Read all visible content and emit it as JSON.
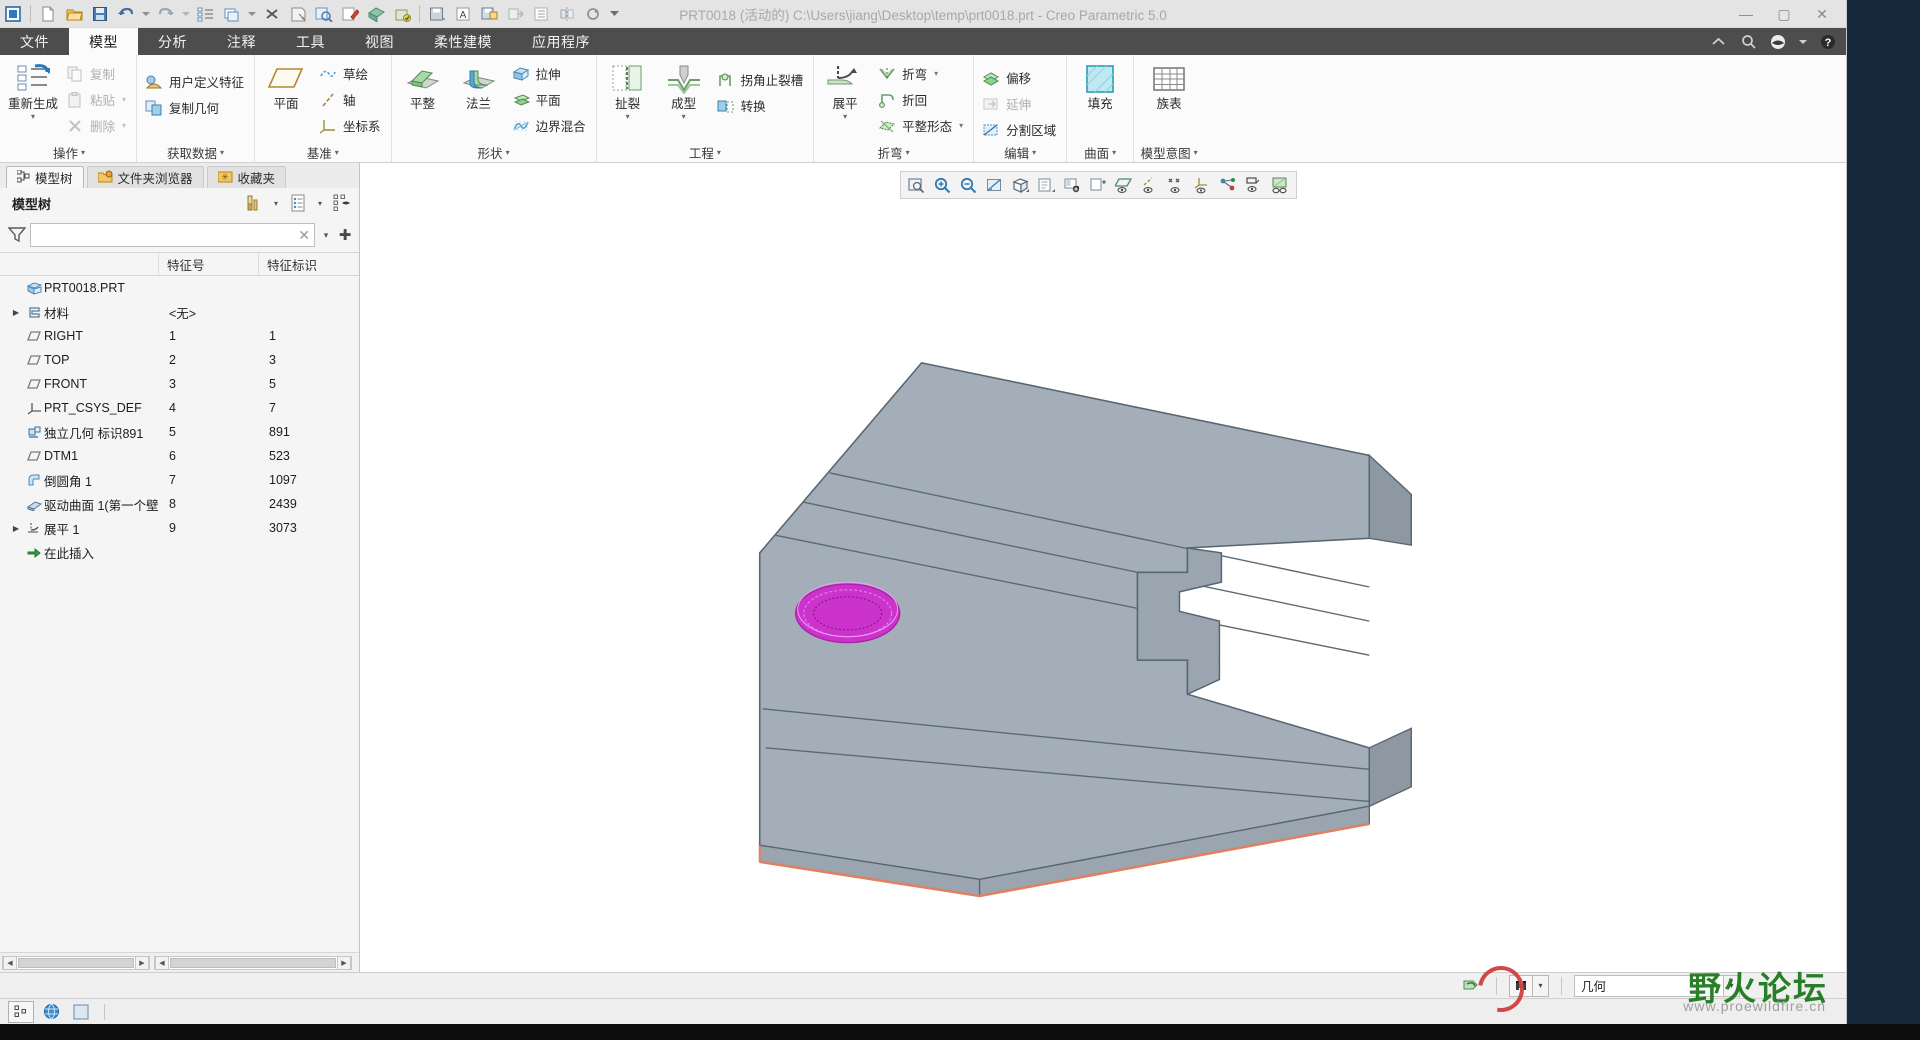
{
  "window": {
    "title": "PRT0018 (活动的) C:\\Users\\jiang\\Desktop\\temp\\prt0018.prt - Creo Parametric 5.0",
    "minimize": "—",
    "maximize": "▢",
    "close": "✕"
  },
  "quick_access": {
    "items": [
      {
        "name": "creo-logo-icon",
        "label": "Creo"
      },
      {
        "name": "new-file-icon",
        "label": "新建"
      },
      {
        "name": "open-file-icon",
        "label": "打开"
      },
      {
        "name": "save-icon",
        "label": "保存"
      },
      {
        "name": "undo-icon",
        "label": "撤消"
      },
      {
        "name": "undo-dropdown-icon",
        "label": "撤消下拉"
      },
      {
        "name": "redo-icon",
        "label": "重做"
      },
      {
        "name": "redo-dropdown-icon",
        "label": "重做下拉"
      },
      {
        "name": "regenerate-icon",
        "label": "重新生成"
      },
      {
        "name": "window-icon",
        "label": "窗口"
      },
      {
        "name": "window-dropdown-icon",
        "label": "窗口下拉"
      },
      {
        "name": "close-window-icon",
        "label": "关闭"
      },
      {
        "name": "save-as-icon",
        "label": "另存为"
      },
      {
        "name": "zoom-find-icon",
        "label": "查找"
      },
      {
        "name": "edit-def-icon",
        "label": "编辑定义"
      },
      {
        "name": "appearance-icon",
        "label": "外观"
      },
      {
        "name": "color-edit-icon",
        "label": "颜色编辑"
      },
      {
        "name": "save-model-icon",
        "label": "保存模型"
      },
      {
        "name": "annotate-icon",
        "label": "注释"
      },
      {
        "name": "save-copy-icon",
        "label": "保存副本"
      },
      {
        "name": "export-icon",
        "label": "导出"
      },
      {
        "name": "list-icon",
        "label": "列表"
      },
      {
        "name": "mirror-icon",
        "label": "镜像"
      },
      {
        "name": "refresh-icon",
        "label": "刷新"
      },
      {
        "name": "qat-overflow-icon",
        "label": "更多"
      }
    ]
  },
  "ribbon": {
    "tabs": [
      {
        "label": "文件",
        "active": false,
        "name": "tab-file"
      },
      {
        "label": "模型",
        "active": true,
        "name": "tab-model"
      },
      {
        "label": "分析",
        "active": false,
        "name": "tab-analysis"
      },
      {
        "label": "注释",
        "active": false,
        "name": "tab-annotate"
      },
      {
        "label": "工具",
        "active": false,
        "name": "tab-tools"
      },
      {
        "label": "视图",
        "active": false,
        "name": "tab-view"
      },
      {
        "label": "柔性建模",
        "active": false,
        "name": "tab-flexible-modeling"
      },
      {
        "label": "应用程序",
        "active": false,
        "name": "tab-applications"
      }
    ],
    "groups": [
      {
        "title": "操作",
        "name": "ribbon-group-operations",
        "big": [
          {
            "label": "重新生成",
            "icon": "regenerate-icon",
            "caret": true
          }
        ],
        "small": [
          {
            "label": "复制",
            "icon": "copy-icon",
            "disabled": true,
            "caret": false
          },
          {
            "label": "粘贴",
            "icon": "paste-icon",
            "disabled": true,
            "caret": true
          },
          {
            "label": "删除",
            "icon": "delete-icon",
            "disabled": true,
            "caret": true
          }
        ]
      },
      {
        "title": "获取数据",
        "name": "ribbon-group-get-data",
        "big": [],
        "small": [
          {
            "label": "用户定义特征",
            "icon": "udf-icon",
            "disabled": false,
            "caret": false
          },
          {
            "label": "复制几何",
            "icon": "copy-geometry-icon",
            "disabled": false,
            "caret": false
          }
        ]
      },
      {
        "title": "基准",
        "name": "ribbon-group-datum",
        "big": [
          {
            "label": "平面",
            "icon": "datum-plane-icon",
            "caret": false
          }
        ],
        "small": [
          {
            "label": "草绘",
            "icon": "sketch-icon",
            "disabled": false,
            "caret": false
          },
          {
            "label": "轴",
            "icon": "datum-axis-icon",
            "disabled": false,
            "caret": false
          },
          {
            "label": "坐标系",
            "icon": "coordinate-system-icon",
            "disabled": false,
            "caret": false
          }
        ]
      },
      {
        "title": "形状",
        "name": "ribbon-group-shape",
        "big": [
          {
            "label": "平整",
            "icon": "flat-wall-icon",
            "caret": false
          },
          {
            "label": "法兰",
            "icon": "flange-wall-icon",
            "caret": false
          }
        ],
        "small": [
          {
            "label": "拉伸",
            "icon": "extrude-icon",
            "disabled": false,
            "caret": false
          },
          {
            "label": "平面",
            "icon": "planar-icon",
            "disabled": false,
            "caret": false
          },
          {
            "label": "边界混合",
            "icon": "boundary-blend-icon",
            "disabled": false,
            "caret": false
          }
        ]
      },
      {
        "title": "工程",
        "name": "ribbon-group-engineering",
        "big": [
          {
            "label": "扯裂",
            "icon": "rip-icon",
            "caret": true
          },
          {
            "label": "成型",
            "icon": "form-icon",
            "caret": true
          }
        ],
        "small": [
          {
            "label": "拐角止裂槽",
            "icon": "corner-relief-icon",
            "disabled": false,
            "caret": false
          },
          {
            "label": "转换",
            "icon": "convert-icon",
            "disabled": false,
            "caret": false
          }
        ]
      },
      {
        "title": "折弯",
        "name": "ribbon-group-bend",
        "big": [
          {
            "label": "展平",
            "icon": "unbend-icon",
            "caret": true
          }
        ],
        "small": [
          {
            "label": "折弯",
            "icon": "bend-icon",
            "disabled": false,
            "caret": true
          },
          {
            "label": "折回",
            "icon": "bend-back-icon",
            "disabled": false,
            "caret": false
          },
          {
            "label": "平整形态",
            "icon": "flat-state-icon",
            "disabled": false,
            "caret": true
          }
        ]
      },
      {
        "title": "编辑",
        "name": "ribbon-group-edit",
        "big": [],
        "small": [
          {
            "label": "偏移",
            "icon": "offset-icon",
            "disabled": false,
            "caret": false
          },
          {
            "label": "延伸",
            "icon": "extend-icon",
            "disabled": true,
            "caret": false
          },
          {
            "label": "分割区域",
            "icon": "split-area-icon",
            "disabled": false,
            "caret": false
          }
        ]
      },
      {
        "title": "曲面",
        "name": "ribbon-group-surface",
        "big": [
          {
            "label": "填充",
            "icon": "fill-icon",
            "caret": false
          }
        ],
        "small": []
      },
      {
        "title": "模型意图",
        "name": "ribbon-group-model-intent",
        "big": [
          {
            "label": "族表",
            "icon": "family-table-icon",
            "caret": false
          }
        ],
        "small": []
      }
    ],
    "right_controls": [
      {
        "name": "ribbon-collapse-icon",
        "label": "^"
      },
      {
        "name": "search-icon",
        "label": "search"
      },
      {
        "name": "help-center-icon",
        "label": "help"
      },
      {
        "name": "help-dropdown-icon",
        "label": "▾"
      },
      {
        "name": "help-icon",
        "label": "?"
      }
    ]
  },
  "left_panel": {
    "nav_tabs": [
      {
        "label": "模型树",
        "active": true,
        "icon": "model-tree-icon",
        "name": "nav-tab-model-tree"
      },
      {
        "label": "文件夹浏览器",
        "active": false,
        "icon": "folder-browser-icon",
        "name": "nav-tab-folder-browser"
      },
      {
        "label": "收藏夹",
        "active": false,
        "icon": "favorites-icon",
        "name": "nav-tab-favorites"
      }
    ],
    "header": {
      "title": "模型树",
      "tools_icon": "tree-tools-icon",
      "settings_icon": "tree-settings-icon",
      "display_icon": "tree-display-icon"
    },
    "filter": {
      "icon": "filter-icon",
      "value": "",
      "placeholder": "",
      "clear": "✕",
      "dropdown": "▾",
      "add": "✚"
    },
    "columns": {
      "name": "",
      "feature_no": "特征号",
      "feature_id": "特征标识"
    },
    "tree": [
      {
        "label": "PRT0018.PRT",
        "no": "",
        "id": "",
        "icon": "part-icon",
        "expand": "none",
        "indent": 0,
        "name": "tree-item-part"
      },
      {
        "label": "材料",
        "no": "<无>",
        "id": "",
        "icon": "material-icon",
        "expand": "collapsed",
        "indent": 1,
        "name": "tree-item-material"
      },
      {
        "label": "RIGHT",
        "no": "1",
        "id": "1",
        "icon": "datum-plane-icon",
        "expand": "none",
        "indent": 1,
        "name": "tree-item-right"
      },
      {
        "label": "TOP",
        "no": "2",
        "id": "3",
        "icon": "datum-plane-icon",
        "expand": "none",
        "indent": 1,
        "name": "tree-item-top"
      },
      {
        "label": "FRONT",
        "no": "3",
        "id": "5",
        "icon": "datum-plane-icon",
        "expand": "none",
        "indent": 1,
        "name": "tree-item-front"
      },
      {
        "label": "PRT_CSYS_DEF",
        "no": "4",
        "id": "7",
        "icon": "coordinate-system-icon",
        "expand": "none",
        "indent": 1,
        "name": "tree-item-csys"
      },
      {
        "label": "独立几何 标识891",
        "no": "5",
        "id": "891",
        "icon": "independent-geometry-icon",
        "expand": "none",
        "indent": 1,
        "name": "tree-item-independent-geometry"
      },
      {
        "label": "DTM1",
        "no": "6",
        "id": "523",
        "icon": "datum-plane-icon",
        "expand": "none",
        "indent": 1,
        "name": "tree-item-dtm1"
      },
      {
        "label": "倒圆角 1",
        "no": "7",
        "id": "1097",
        "icon": "round-icon",
        "expand": "none",
        "indent": 1,
        "name": "tree-item-round1"
      },
      {
        "label": "驱动曲面 1(第一个壁",
        "no": "8",
        "id": "2439",
        "icon": "driving-surface-icon",
        "expand": "none",
        "indent": 1,
        "name": "tree-item-driving-surface1"
      },
      {
        "label": "展平 1",
        "no": "9",
        "id": "3073",
        "icon": "unbend-icon",
        "expand": "collapsed",
        "indent": 1,
        "name": "tree-item-unbend1"
      },
      {
        "label": "在此插入",
        "no": "",
        "id": "",
        "icon": "insert-here-icon",
        "expand": "none",
        "indent": 1,
        "name": "tree-item-insert-here"
      }
    ]
  },
  "viewport": {
    "toolbar": [
      {
        "name": "zoom-to-fit-icon",
        "label": "重新调整"
      },
      {
        "name": "zoom-in-icon",
        "label": "放大"
      },
      {
        "name": "zoom-out-icon",
        "label": "缩小"
      },
      {
        "name": "repaint-icon",
        "label": "重画"
      },
      {
        "name": "saved-orientation-icon",
        "label": "已保存方向",
        "caret": true
      },
      {
        "name": "view-manager-icon",
        "label": "视图管理器",
        "caret": true
      },
      {
        "name": "model-display-icon",
        "label": "模型显示"
      },
      {
        "name": "scene-icon",
        "label": "场景"
      },
      {
        "name": "datum-plane-display-icon",
        "label": "平面显示"
      },
      {
        "name": "datum-axis-display-icon",
        "label": "轴显示"
      },
      {
        "name": "datum-point-display-icon",
        "label": "点显示"
      },
      {
        "name": "csys-display-icon",
        "label": "坐标系显示"
      },
      {
        "name": "annotation-display-icon",
        "label": "注释显示"
      },
      {
        "name": "spin-center-icon",
        "label": "旋转中心",
        "caret": true
      },
      {
        "name": "display-style-icon",
        "label": "显示样式"
      }
    ],
    "model": {
      "name": "sheet-metal-part",
      "body_color": "#9aa5b0",
      "edge_color": "#5a646e",
      "highlight_color": "#cc33cc",
      "bottom_edge_color": "#e08060"
    }
  },
  "status_bar": {
    "regenerate_icon": "regenerate-status-icon",
    "search_icon": "binoculars-icon",
    "search_caret": "▾",
    "filter_value": "几何",
    "filter_caret": "▾"
  },
  "bottom_dock": [
    {
      "name": "layer-tree-icon",
      "label": "层树"
    },
    {
      "name": "browser-icon",
      "label": "浏览器"
    },
    {
      "name": "navigator-icon",
      "label": "导航器"
    }
  ],
  "watermark": {
    "title": "野火论坛",
    "subtitle": "www.proewildfire.cn"
  }
}
